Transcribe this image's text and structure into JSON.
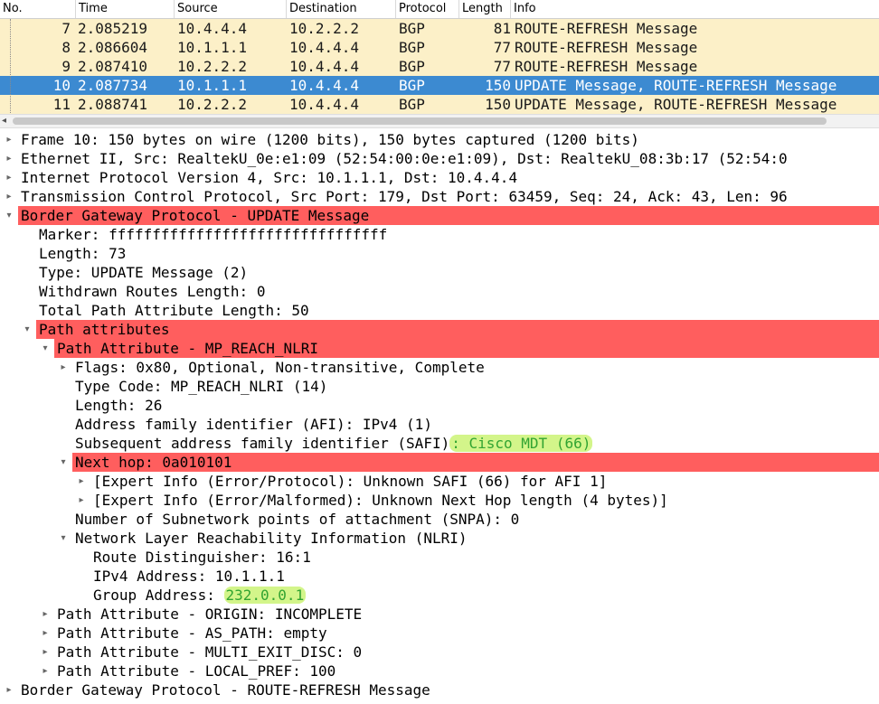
{
  "packet_list": {
    "headers": {
      "no": "No.",
      "time": "Time",
      "source": "Source",
      "destination": "Destination",
      "protocol": "Protocol",
      "length": "Length",
      "info": "Info"
    },
    "rows": [
      {
        "no": "7",
        "time": "2.085219",
        "source": "10.4.4.4",
        "destination": "10.2.2.2",
        "protocol": "BGP",
        "length": "81",
        "info": "ROUTE-REFRESH Message",
        "selected": false
      },
      {
        "no": "8",
        "time": "2.086604",
        "source": "10.1.1.1",
        "destination": "10.4.4.4",
        "protocol": "BGP",
        "length": "77",
        "info": "ROUTE-REFRESH Message",
        "selected": false
      },
      {
        "no": "9",
        "time": "2.087410",
        "source": "10.2.2.2",
        "destination": "10.4.4.4",
        "protocol": "BGP",
        "length": "77",
        "info": "ROUTE-REFRESH Message",
        "selected": false
      },
      {
        "no": "10",
        "time": "2.087734",
        "source": "10.1.1.1",
        "destination": "10.4.4.4",
        "protocol": "BGP",
        "length": "150",
        "info": "UPDATE Message, ROUTE-REFRESH Message",
        "selected": true
      },
      {
        "no": "11",
        "time": "2.088741",
        "source": "10.2.2.2",
        "destination": "10.4.4.4",
        "protocol": "BGP",
        "length": "150",
        "info": "UPDATE Message, ROUTE-REFRESH Message",
        "selected": false
      }
    ],
    "colors": {
      "row_bg": "#fcf0c8",
      "selected_bg": "#3c8ad1"
    }
  },
  "details": {
    "colors": {
      "highlight": "#ff5e5e",
      "green_mark": "#d3f58a",
      "green_text": "#32a432"
    },
    "frame": "Frame 10: 150 bytes on wire (1200 bits), 150 bytes captured (1200 bits)",
    "ethernet": "Ethernet II, Src: RealtekU_0e:e1:09 (52:54:00:0e:e1:09), Dst: RealtekU_08:3b:17 (52:54:0",
    "ip": "Internet Protocol Version 4, Src: 10.1.1.1, Dst: 10.4.4.4",
    "tcp": "Transmission Control Protocol, Src Port: 179, Dst Port: 63459, Seq: 24, Ack: 43, Len: 96",
    "bgp_update": "Border Gateway Protocol - UPDATE Message",
    "marker": "Marker: ffffffffffffffffffffffffffffffff",
    "length": "Length: 73",
    "type": "Type: UPDATE Message (2)",
    "withdrawn": "Withdrawn Routes Length: 0",
    "total_path": "Total Path Attribute Length: 50",
    "path_attributes": "Path attributes",
    "mp_reach": "Path Attribute - MP_REACH_NLRI",
    "flags": "Flags: 0x80, Optional, Non-transitive, Complete",
    "type_code": "Type Code: MP_REACH_NLRI (14)",
    "attr_length": "Length: 26",
    "afi": "Address family identifier (AFI): IPv4 (1)",
    "safi_label": "Subsequent address family identifier (SAFI)",
    "safi_value": ": Cisco MDT (66)",
    "next_hop": "Next hop: 0a010101",
    "expert1": "[Expert Info (Error/Protocol): Unknown SAFI (66) for AFI 1]",
    "expert2": "[Expert Info (Error/Malformed): Unknown Next Hop length (4 bytes)]",
    "snpa": "Number of Subnetwork points of attachment (SNPA): 0",
    "nlri": "Network Layer Reachability Information (NLRI)",
    "route_dist": "Route Distinguisher: 16:1",
    "ipv4_addr": "IPv4 Address: 10.1.1.1",
    "group_label": "Group Address: ",
    "group_value": "232.0.0.1",
    "origin": "Path Attribute - ORIGIN: INCOMPLETE",
    "as_path": "Path Attribute - AS_PATH: empty",
    "med": "Path Attribute - MULTI_EXIT_DISC: 0",
    "local_pref": "Path Attribute - LOCAL_PREF: 100",
    "bgp_refresh": "Border Gateway Protocol - ROUTE-REFRESH Message"
  }
}
